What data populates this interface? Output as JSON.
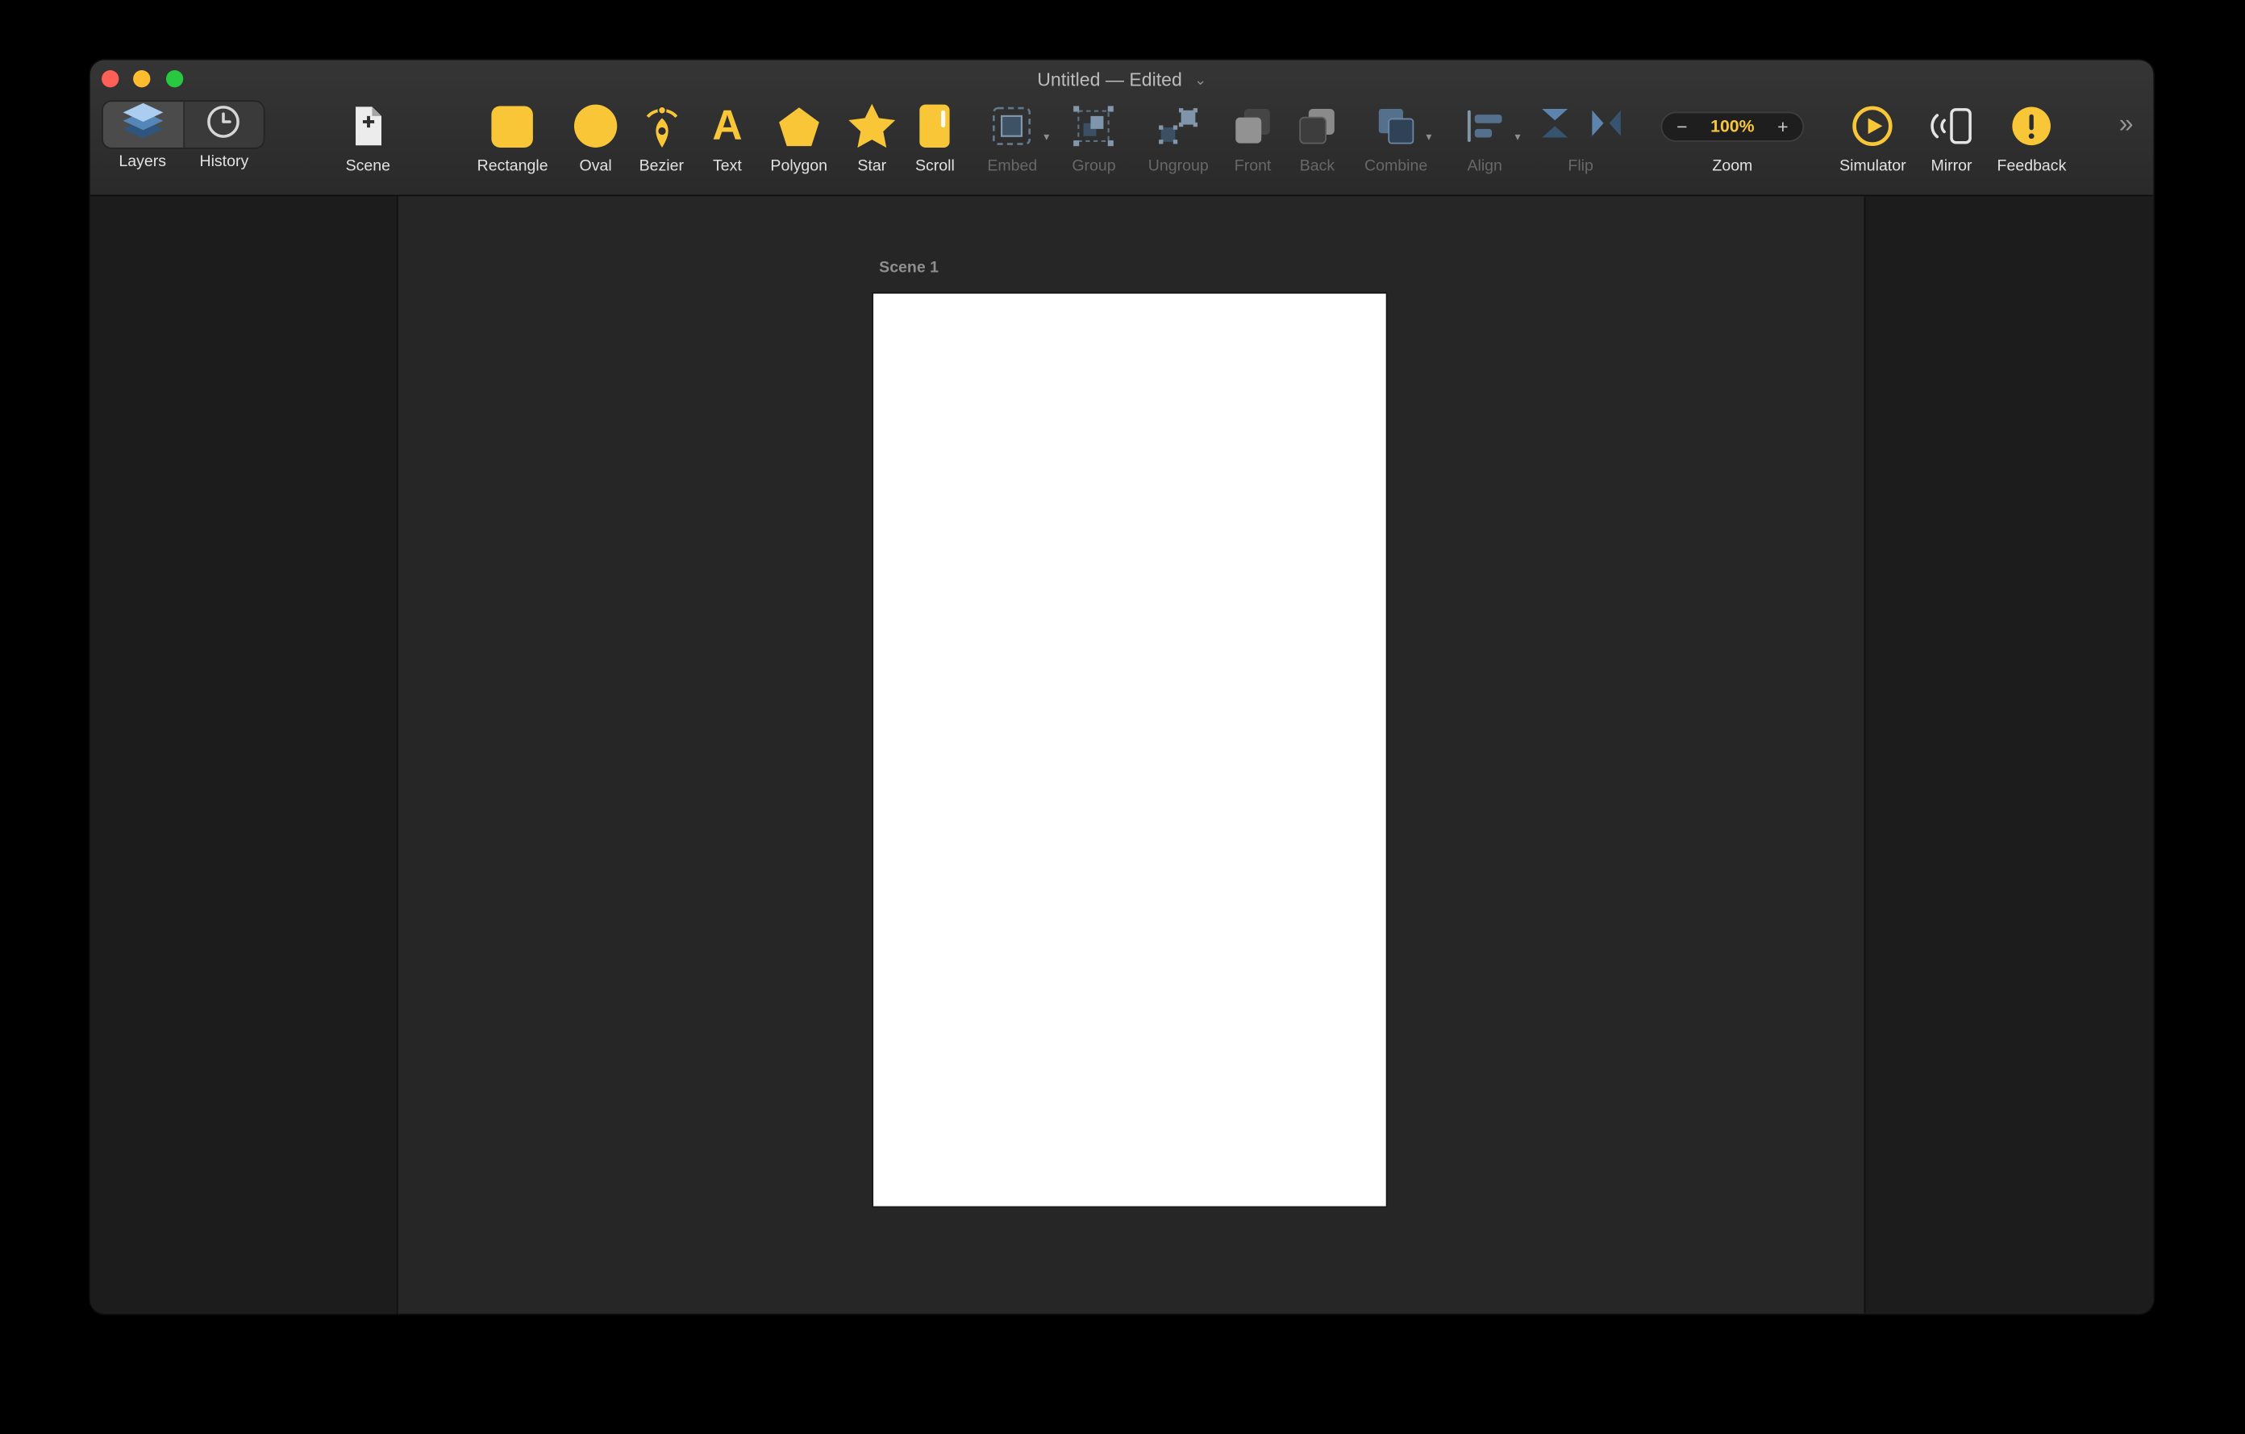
{
  "window": {
    "title": "Untitled — Edited",
    "title_chevron": "⌄",
    "overflow_chevron": "»"
  },
  "toolbar": {
    "layers": {
      "label": "Layers"
    },
    "history": {
      "label": "History"
    },
    "scene": {
      "label": "Scene"
    },
    "rectangle": {
      "label": "Rectangle"
    },
    "oval": {
      "label": "Oval"
    },
    "bezier": {
      "label": "Bezier"
    },
    "text": {
      "label": "Text",
      "glyph": "A"
    },
    "polygon": {
      "label": "Polygon"
    },
    "star": {
      "label": "Star"
    },
    "scroll": {
      "label": "Scroll"
    },
    "embed": {
      "label": "Embed"
    },
    "group": {
      "label": "Group"
    },
    "ungroup": {
      "label": "Ungroup"
    },
    "front": {
      "label": "Front"
    },
    "back": {
      "label": "Back"
    },
    "combine": {
      "label": "Combine"
    },
    "align": {
      "label": "Align"
    },
    "flip": {
      "label": "Flip"
    },
    "zoom": {
      "label": "Zoom",
      "value": "100%",
      "decrease": "−",
      "increase": "+"
    },
    "simulator": {
      "label": "Simulator"
    },
    "mirror": {
      "label": "Mirror"
    },
    "feedback": {
      "label": "Feedback"
    }
  },
  "canvas": {
    "scene_label": "Scene 1"
  },
  "colors": {
    "accent": "#F8C637",
    "toolbar_bg": "#2E2E2E",
    "canvas_bg": "#262626",
    "sidebar_bg": "#1C1C1C"
  }
}
